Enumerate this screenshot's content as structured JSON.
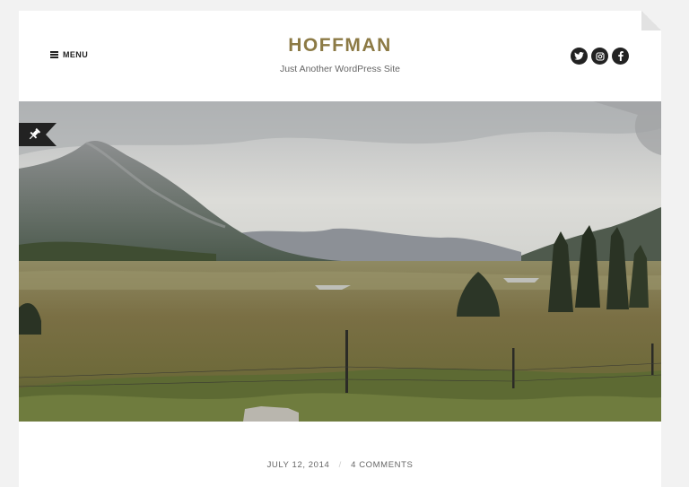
{
  "header": {
    "menu_label": "MENU",
    "site_title": "HOFFMAN",
    "tagline": "Just Another WordPress Site",
    "social": [
      {
        "icon": "twitter-icon"
      },
      {
        "icon": "instagram-icon"
      },
      {
        "icon": "facebook-icon"
      }
    ]
  },
  "post": {
    "date": "JULY 12, 2014",
    "separator": "/",
    "comments": "4 COMMENTS",
    "sticky_icon": "pin-icon"
  },
  "colors": {
    "title": "#8c7a45",
    "dark": "#222222",
    "meta": "#666666",
    "background": "#f2f2f2"
  }
}
